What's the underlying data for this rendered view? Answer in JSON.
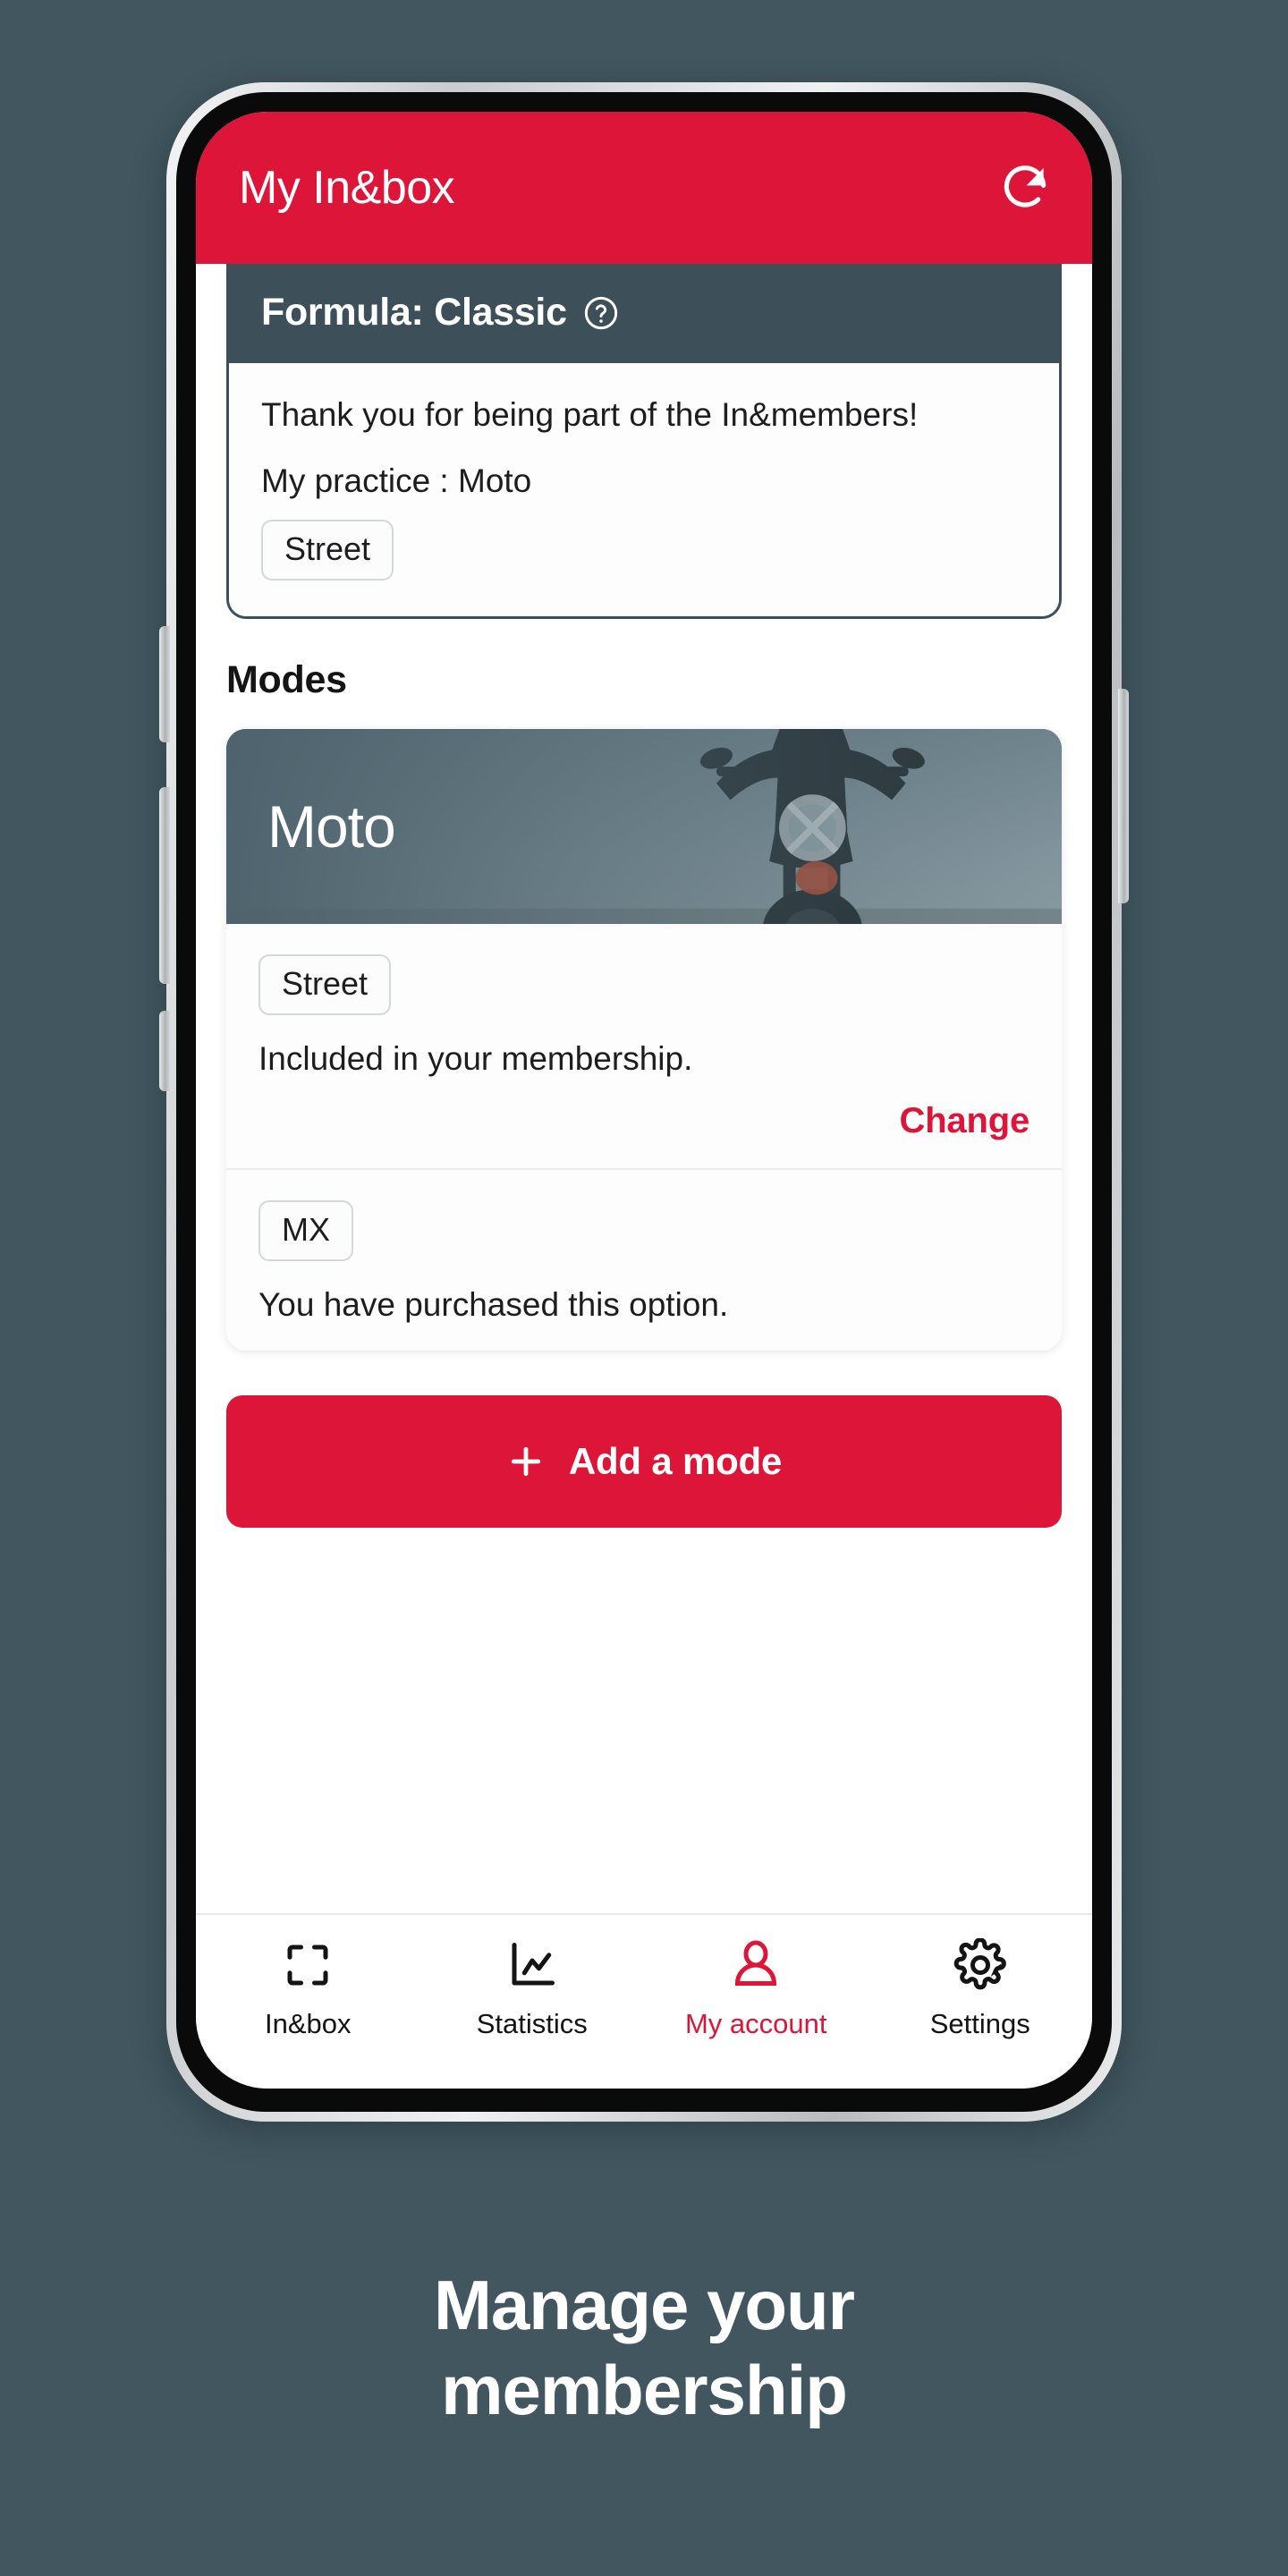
{
  "background_color": "#41565f",
  "accent_color": "#dd1639",
  "slate_color": "#3d5059",
  "app": {
    "header": {
      "title": "My In&box",
      "refresh_icon": "refresh-icon"
    },
    "formula_card": {
      "title": "Formula: Classic",
      "help_icon": "help-circle-icon",
      "thanks_text": "Thank you for being part of the In&members!",
      "practice_label": "My practice : Moto",
      "practice_chip": "Street"
    },
    "modes_section": {
      "heading": "Modes",
      "card": {
        "hero_title": "Moto",
        "hero_image": "motorcycle-rider-photo",
        "rows": [
          {
            "chip": "Street",
            "description": "Included in your membership.",
            "action_label": "Change"
          },
          {
            "chip": "MX",
            "description": "You have purchased this option.",
            "action_label": ""
          }
        ]
      },
      "add_button": {
        "label": "Add a mode",
        "icon": "plus-icon"
      }
    },
    "bottom_nav": [
      {
        "label": "In&box",
        "icon": "scan-frame-icon",
        "active": false
      },
      {
        "label": "Statistics",
        "icon": "line-chart-icon",
        "active": false
      },
      {
        "label": "My account",
        "icon": "person-icon",
        "active": true
      },
      {
        "label": "Settings",
        "icon": "gear-icon",
        "active": false
      }
    ]
  },
  "caption": {
    "line1": "Manage your",
    "line2": "membership"
  }
}
